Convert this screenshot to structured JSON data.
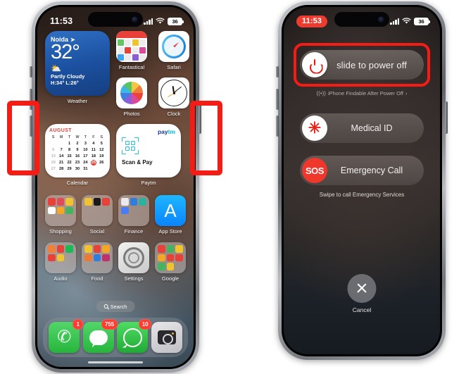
{
  "meta": {
    "accent_red": "#f41c14",
    "ios_red": "#ff3b30"
  },
  "left_phone": {
    "status_bar": {
      "time": "11:53",
      "signal_icon": "cellular-bars-icon",
      "wifi_icon": "wifi-icon",
      "battery_level": "36"
    },
    "weather_widget": {
      "city": "Noida",
      "location_icon": "location-arrow-icon",
      "temperature": "32°",
      "condition_icon": "partly-cloudy-icon",
      "condition": "Partly Cloudy",
      "high_low": "H:34° L:26°",
      "label": "Weather"
    },
    "top_apps": [
      {
        "name": "Fantastical",
        "icon": "fantastical-icon"
      },
      {
        "name": "Safari",
        "icon": "safari-icon"
      },
      {
        "name": "Photos",
        "icon": "photos-icon"
      },
      {
        "name": "Clock",
        "icon": "clock-icon"
      }
    ],
    "calendar_widget": {
      "month": "AUGUST",
      "weekdays": [
        "S",
        "M",
        "T",
        "W",
        "T",
        "F",
        "S"
      ],
      "weeks": [
        [
          "",
          "",
          "1",
          "2",
          "3",
          "4",
          "5"
        ],
        [
          "6",
          "7",
          "8",
          "9",
          "10",
          "11",
          "12"
        ],
        [
          "13",
          "14",
          "15",
          "16",
          "17",
          "18",
          "19"
        ],
        [
          "20",
          "21",
          "22",
          "23",
          "24",
          "25",
          "26"
        ],
        [
          "27",
          "28",
          "29",
          "30",
          "31",
          "",
          ""
        ]
      ],
      "today": "25",
      "dim_days": [
        "6",
        "13",
        "20",
        "27"
      ],
      "label": "Calendar"
    },
    "paytm_widget": {
      "brand_a": "pay",
      "brand_b": "tm",
      "qr_icon": "qr-code-icon",
      "action": "Scan & Pay",
      "label": "Paytm"
    },
    "folders_row1": [
      {
        "name": "Shopping",
        "type": "folder"
      },
      {
        "name": "Social",
        "type": "folder"
      },
      {
        "name": "Finance",
        "type": "folder"
      },
      {
        "name": "App Store",
        "type": "app",
        "icon": "app-store-icon"
      }
    ],
    "folders_row2": [
      {
        "name": "Audio",
        "type": "folder"
      },
      {
        "name": "Food",
        "type": "folder"
      },
      {
        "name": "Settings",
        "type": "app",
        "icon": "settings-gear-icon"
      },
      {
        "name": "Google",
        "type": "folder"
      }
    ],
    "search": {
      "icon": "search-icon",
      "label": "Search"
    },
    "dock": [
      {
        "name": "Phone",
        "icon": "phone-icon",
        "badge": "1"
      },
      {
        "name": "Messages",
        "icon": "messages-icon",
        "badge": "755"
      },
      {
        "name": "WhatsApp",
        "icon": "whatsapp-icon",
        "badge": "10"
      },
      {
        "name": "Camera",
        "icon": "camera-icon",
        "badge": ""
      }
    ],
    "side_buttons": {
      "volume_up": "volume-up-button",
      "volume_down": "volume-down-button",
      "silent_switch": "ring-silent-switch",
      "side_button": "side-power-button"
    }
  },
  "right_phone": {
    "status_bar": {
      "time": "11:53",
      "time_pill_color": "#ee3b30",
      "signal_icon": "cellular-bars-icon",
      "wifi_icon": "wifi-icon",
      "battery_level": "36"
    },
    "power_slider": {
      "power_icon": "power-icon",
      "label": "slide to power off",
      "highlighted": true
    },
    "findable_note": {
      "icon": "findmy-signal-icon",
      "text": "iPhone Findable After Power Off",
      "chevron": "›"
    },
    "medical_id": {
      "icon": "medical-asterisk-icon",
      "label": "Medical ID"
    },
    "emergency_call": {
      "icon": "sos-icon",
      "icon_text": "SOS",
      "label": "Emergency Call"
    },
    "swipe_note": "Swipe to call Emergency Services",
    "cancel": {
      "icon": "close-x-icon",
      "label": "Cancel"
    }
  },
  "annotations": [
    {
      "name": "volume-buttons-highlight",
      "side": "left"
    },
    {
      "name": "side-button-highlight",
      "side": "right"
    }
  ]
}
